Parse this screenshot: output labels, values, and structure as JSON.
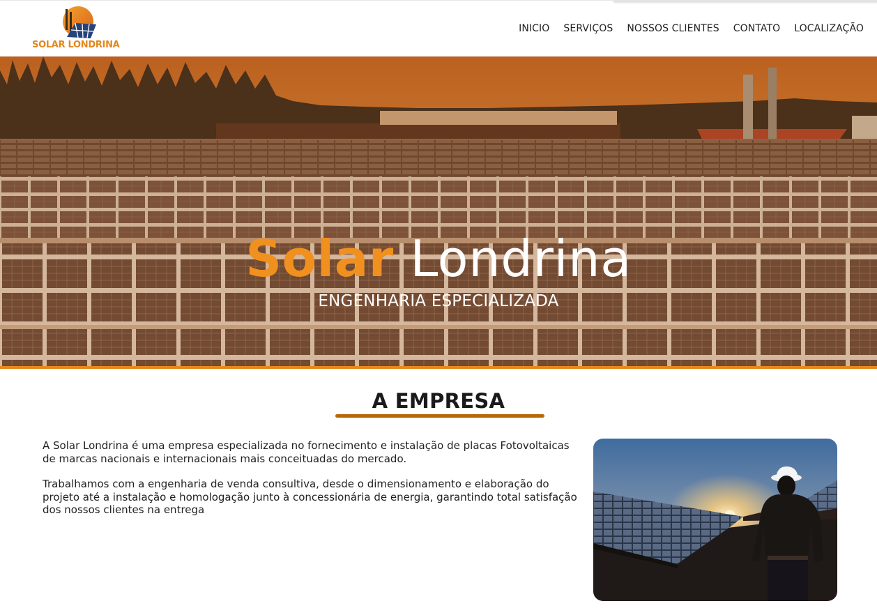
{
  "brand": {
    "logo_text": "SOLAR LONDRINA",
    "accent_color": "#e3871d"
  },
  "nav": {
    "items": [
      {
        "label": "INICIO"
      },
      {
        "label": "SERVIÇOS"
      },
      {
        "label": "NOSSOS CLIENTES"
      },
      {
        "label": "CONTATO"
      },
      {
        "label": "LOCALIZAÇÃO"
      }
    ]
  },
  "hero": {
    "title_highlight": "Solar",
    "title_rest": "Londrina",
    "subtitle": "ENGENHARIA ESPECIALIZADA",
    "highlight_color": "#f0901f",
    "border_color": "#e6891c"
  },
  "about": {
    "title": "A EMPRESA",
    "paragraphs": [
      "A Solar Londrina é uma empresa especializada no fornecimento e instalação de placas Fotovoltaicas de marcas nacionais e internacionais mais conceituadas do mercado.",
      "Trabalhamos com a engenharia de venda consultiva, desde o dimensionamento e elaboração do projeto até a instalação e homologação junto à concessionária de energia, garantindo total satisfação dos nossos clientes na entrega"
    ],
    "bar_color": "#b8680c"
  }
}
